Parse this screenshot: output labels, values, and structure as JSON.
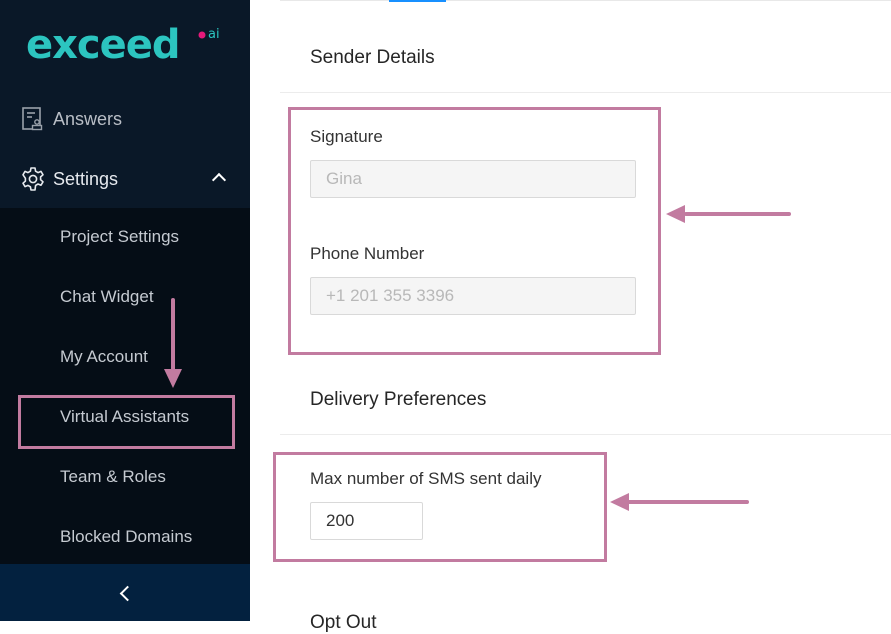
{
  "brand": {
    "logo_text": "exceed",
    "logo_suffix": "ai",
    "logo_color": "#2cc5c0",
    "logo_dot_color": "#e5197a"
  },
  "sidebar": {
    "items": [
      {
        "label": "Answers",
        "icon": "answers-document-icon"
      },
      {
        "label": "Settings",
        "icon": "gear-icon",
        "expanded": true
      }
    ],
    "submenu": [
      {
        "label": "Project Settings"
      },
      {
        "label": "Chat Widget"
      },
      {
        "label": "My Account"
      },
      {
        "label": "Virtual Assistants",
        "highlighted": true
      },
      {
        "label": "Team & Roles"
      },
      {
        "label": "Blocked Domains"
      }
    ],
    "collapse_icon": "chevron-left-icon"
  },
  "main": {
    "sections": [
      {
        "title": "Sender Details",
        "fields": [
          {
            "label": "Signature",
            "value": "Gina",
            "disabled": true
          },
          {
            "label": "Phone Number",
            "value": "+1 201 355 3396",
            "disabled": true
          }
        ]
      },
      {
        "title": "Delivery Preferences",
        "fields": [
          {
            "label": "Max number of SMS sent daily",
            "value": "200",
            "disabled": false
          }
        ]
      },
      {
        "title": "Opt Out"
      }
    ],
    "active_tab_color": "#1890ff"
  },
  "annotations": {
    "color": "#c27ba0"
  }
}
